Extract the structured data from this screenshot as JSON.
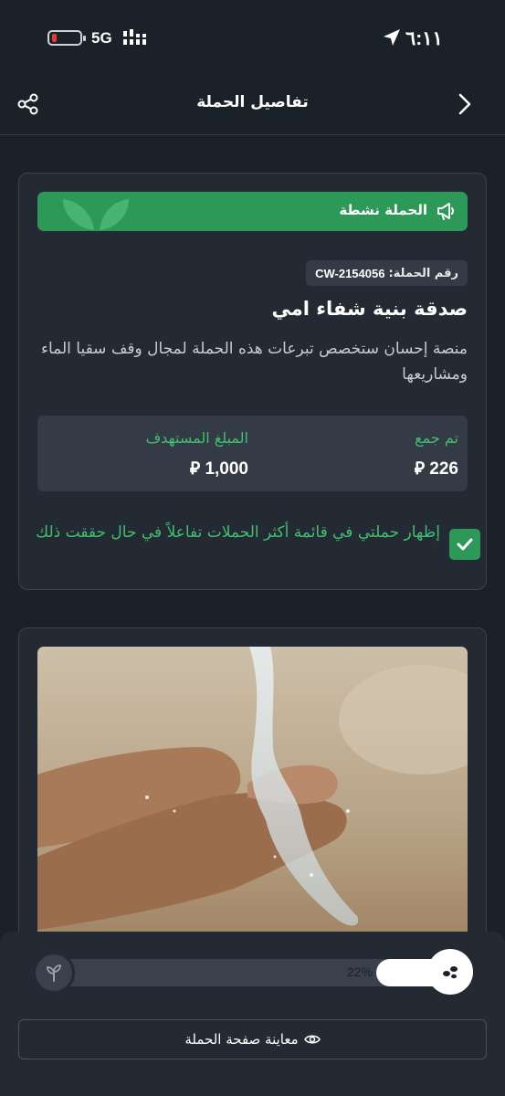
{
  "status_bar": {
    "time": "٦:١١",
    "network": "5G"
  },
  "header": {
    "title": "تفاصيل الحملة"
  },
  "campaign": {
    "status_label": "الحملة نشطة",
    "id_label": "رقم الحملة:",
    "id_value": "CW-2154056",
    "title": "صدقة بنية شفاء امي",
    "description": "منصة إحسان ستخصص تبرعات هذه الحملة لمجال وقف سقيا الماء ومشاريعها",
    "stats": {
      "collected_label": "تم جمع",
      "collected_value": "226",
      "target_label": "المبلغ المستهدف",
      "target_value": "1,000",
      "currency_symbol": "⃁"
    },
    "featured_option": {
      "label": "إظهار حملتي في قائمة أكثر الحملات تفاعلاً في حال حققت ذلك",
      "checked": true
    }
  },
  "progress": {
    "percent_label": "22%",
    "fraction": 0.22
  },
  "preview_button": {
    "label": "معاينة صفحة الحملة"
  },
  "colors": {
    "background": "#1b2129",
    "card": "#232a33",
    "accent_green": "#2d9958",
    "text_green": "#3fbf6f"
  },
  "icons": {
    "back": "chevron-right-icon",
    "share": "share-icon",
    "status": "megaphone-icon",
    "checkbox": "check-icon",
    "preview": "eye-icon"
  }
}
